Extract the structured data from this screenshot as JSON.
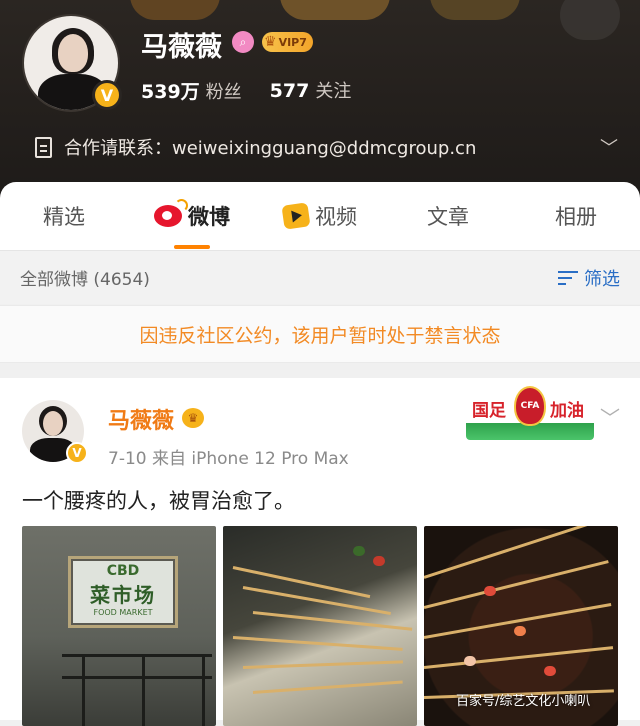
{
  "profile": {
    "name": "马薇薇",
    "vip_label": "VIP7",
    "followers_count": "539万",
    "followers_label": "粉丝",
    "following_count": "577",
    "following_label": "关注",
    "contact_text": "合作请联系：weiweixingguang@ddmcgroup.cn"
  },
  "tabs": [
    {
      "label": "精选",
      "icon": null
    },
    {
      "label": "微博",
      "icon": "weibo-logo-icon",
      "active": true
    },
    {
      "label": "视频",
      "icon": "video-logo-icon"
    },
    {
      "label": "文章",
      "icon": null
    },
    {
      "label": "相册",
      "icon": null
    }
  ],
  "filter_bar": {
    "all_label": "全部微博 (4654)",
    "filter_label": "筛选"
  },
  "notice": "因违反社区公约，该用户暂时处于禁言状态",
  "post": {
    "author": "马薇薇",
    "meta": "7-10  来自 iPhone 12 Pro Max",
    "badge_left": "国足",
    "badge_right": "加油",
    "badge_emblem": "CFA",
    "text": "一个腰疼的人，被胃治愈了。",
    "photo1_sign": {
      "line1": "CBD",
      "line2": "菜市场",
      "line3": "FOOD  MARKET"
    }
  },
  "watermark": "百家号/综艺文化小喇叭",
  "colors": {
    "accent": "#ff8200",
    "link_blue": "#2a6ec5",
    "notice_orange": "#f28a24",
    "author_orange": "#f07b16"
  }
}
